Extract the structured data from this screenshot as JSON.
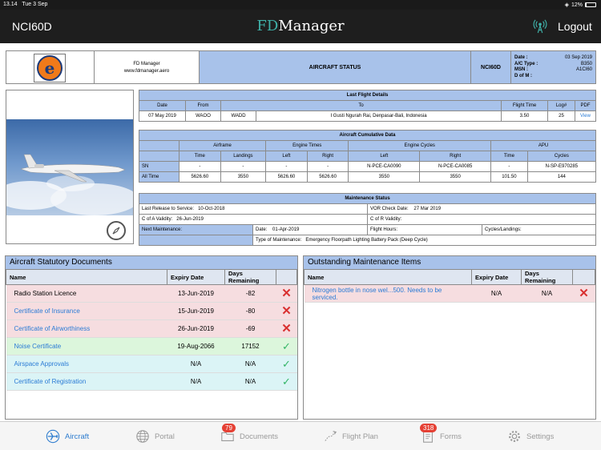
{
  "status_bar": {
    "time": "13.14",
    "date": "Tue 3 Sep",
    "battery": "12%"
  },
  "app_header": {
    "tail_number": "NCI60D",
    "brand_fd": "FD",
    "brand_rest": "Manager",
    "logout_label": "Logout"
  },
  "info_header": {
    "company": "FD Manager",
    "website": "www.fdmanager.aero",
    "title": "AIRCRAFT STATUS",
    "registration": "NCI60D",
    "date_label": "Date :",
    "date_value": "03 Sep 2019",
    "ac_type_label": "A/C Type :",
    "ac_type_value": "B350",
    "msn_label": "MSN :",
    "msn_value": "A1CI60",
    "dofm_label": "D of M :",
    "dofm_value": ""
  },
  "last_flight": {
    "caption": "Last Flight Details",
    "headers": [
      "Date",
      "From",
      "To",
      "Flight Time",
      "Log#",
      "PDF"
    ],
    "row": {
      "date": "07 May 2019",
      "from": "WAOO",
      "to_code": "WADD",
      "to_name": "I Gusti Ngurah Rai, Denpasar-Bali, Indonesia",
      "flight_time": "3.50",
      "log": "25",
      "pdf": "View"
    }
  },
  "cumulative": {
    "caption": "Aircraft Cumulative Data",
    "groups": [
      "Airframe",
      "Engine Times",
      "Engine Cycles",
      "APU"
    ],
    "subheaders": [
      "Time",
      "Landings",
      "Left",
      "Right",
      "Left",
      "Right",
      "Time",
      "Cycles"
    ],
    "rows": [
      {
        "label": "SN",
        "cells": [
          "-",
          "-",
          "-",
          "-",
          "N-PCE-CA0090",
          "N-PCE-CA0085",
          "-",
          "N-SP-E970285"
        ]
      },
      {
        "label": "All Time",
        "cells": [
          "5626.60",
          "3550",
          "5626.60",
          "5626.60",
          "3550",
          "3550",
          "101.50",
          "144"
        ]
      }
    ]
  },
  "maintenance_status": {
    "caption": "Maintenance Status",
    "last_release_label": "Last Release to Service:",
    "last_release_value": "10-Oct-2018",
    "vor_label": "VOR Check Date:",
    "vor_value": "27 Mar 2019",
    "coa_label": "C of A Validity:",
    "coa_value": "26-Jun-2019",
    "cor_label": "C of R Validity:",
    "cor_value": "",
    "next_label": "Next Maintenance:",
    "next_date_label": "Date:",
    "next_date_value": "01-Apr-2019",
    "flight_hours_label": "Flight Hours:",
    "cycles_label": "Cycles/Landings:",
    "type_label": "Type of Maintenance:",
    "type_value": "Emergency Floorpath Lighting Battery Pack (Deep Cycle)"
  },
  "statutory_docs": {
    "title": "Aircraft Statutory Documents",
    "headers": [
      "Name",
      "Expiry Date",
      "Days Remaining"
    ],
    "rows": [
      {
        "name": "Radio Station Licence",
        "expiry": "13-Jun-2019",
        "days": "-82",
        "status": "expired"
      },
      {
        "name": "Certificate of Insurance",
        "expiry": "15-Jun-2019",
        "days": "-80",
        "status": "expired"
      },
      {
        "name": "Certificate of Airworthiness",
        "expiry": "26-Jun-2019",
        "days": "-69",
        "status": "expired"
      },
      {
        "name": "Noise Certificate",
        "expiry": "19-Aug-2066",
        "days": "17152",
        "status": "valid"
      },
      {
        "name": "Airspace Approvals",
        "expiry": "N/A",
        "days": "N/A",
        "status": "na"
      },
      {
        "name": "Certificate of Registration",
        "expiry": "N/A",
        "days": "N/A",
        "status": "na"
      }
    ]
  },
  "outstanding_items": {
    "title": "Outstanding Maintenance Items",
    "headers": [
      "Name",
      "Expiry Date",
      "Days Remaining"
    ],
    "rows": [
      {
        "name": "Nitrogen bottle in nose wel...500. Needs to be serviced.",
        "expiry": "N/A",
        "days": "N/A",
        "status": "expired"
      }
    ]
  },
  "tab_bar": {
    "tabs": [
      {
        "label": "Aircraft",
        "icon": "plane-icon",
        "active": true,
        "badge": ""
      },
      {
        "label": "Portal",
        "icon": "globe-icon",
        "active": false,
        "badge": ""
      },
      {
        "label": "Documents",
        "icon": "folder-icon",
        "active": false,
        "badge": "79"
      },
      {
        "label": "Flight Plan",
        "icon": "flight-plan-icon",
        "active": false,
        "badge": ""
      },
      {
        "label": "Forms",
        "icon": "forms-icon",
        "active": false,
        "badge": "318"
      },
      {
        "label": "Settings",
        "icon": "gear-icon",
        "active": false,
        "badge": ""
      }
    ]
  },
  "colors": {
    "header_blue": "#a8c2ea",
    "link_blue": "#2a7bd5",
    "expired_row": "#f6dde0",
    "valid_row": "#dcf6dc",
    "na_row": "#dbf4f6",
    "accent": "#2f7dcf"
  }
}
